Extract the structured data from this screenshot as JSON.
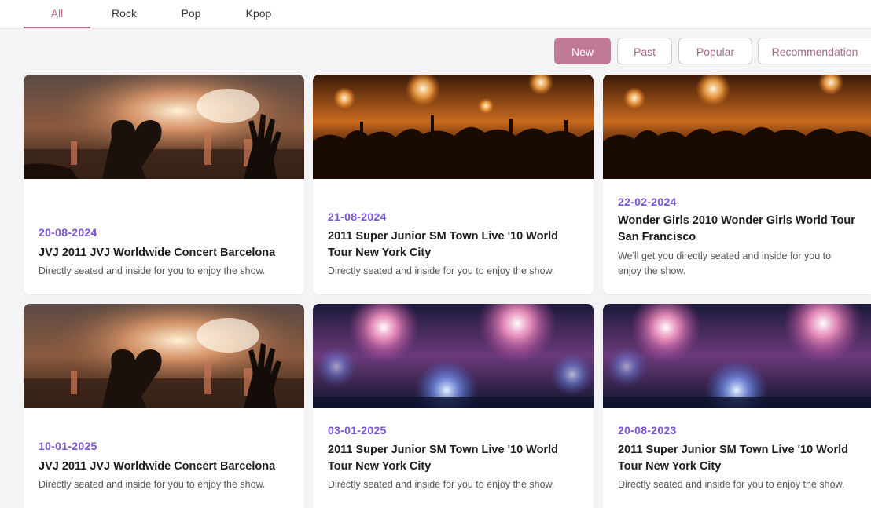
{
  "tabs": [
    "All",
    "Rock",
    "Pop",
    "Kpop"
  ],
  "filters": [
    "New",
    "Past",
    "Popular",
    "Recommendation"
  ],
  "colors": {
    "accent": "#b56f8d",
    "date": "#7a52d4"
  },
  "cards": [
    {
      "date": "20-08-2024",
      "title": "JVJ 2011 JVJ Worldwide Concert Barcelona",
      "desc": "Directly seated and inside for you to enjoy the show."
    },
    {
      "date": "21-08-2024",
      "title": "2011 Super Junior SM Town Live '10 World Tour New York City",
      "desc": "Directly seated and inside for you to enjoy the show."
    },
    {
      "date": "22-02-2024",
      "title": "Wonder Girls 2010 Wonder Girls World Tour San Francisco",
      "desc": "We'll get you directly seated and inside for you to enjoy the show."
    },
    {
      "date": "10-01-2025",
      "title": "JVJ 2011 JVJ Worldwide Concert Barcelona",
      "desc": "Directly seated and inside for you to enjoy the show."
    },
    {
      "date": "03-01-2025",
      "title": "2011 Super Junior SM Town Live '10 World Tour New York City",
      "desc": "Directly seated and inside for you to enjoy the show."
    },
    {
      "date": "20-08-2023",
      "title": "2011 Super Junior SM Town Live '10 World Tour New York City",
      "desc": "Directly seated and inside for you to enjoy the show."
    }
  ]
}
